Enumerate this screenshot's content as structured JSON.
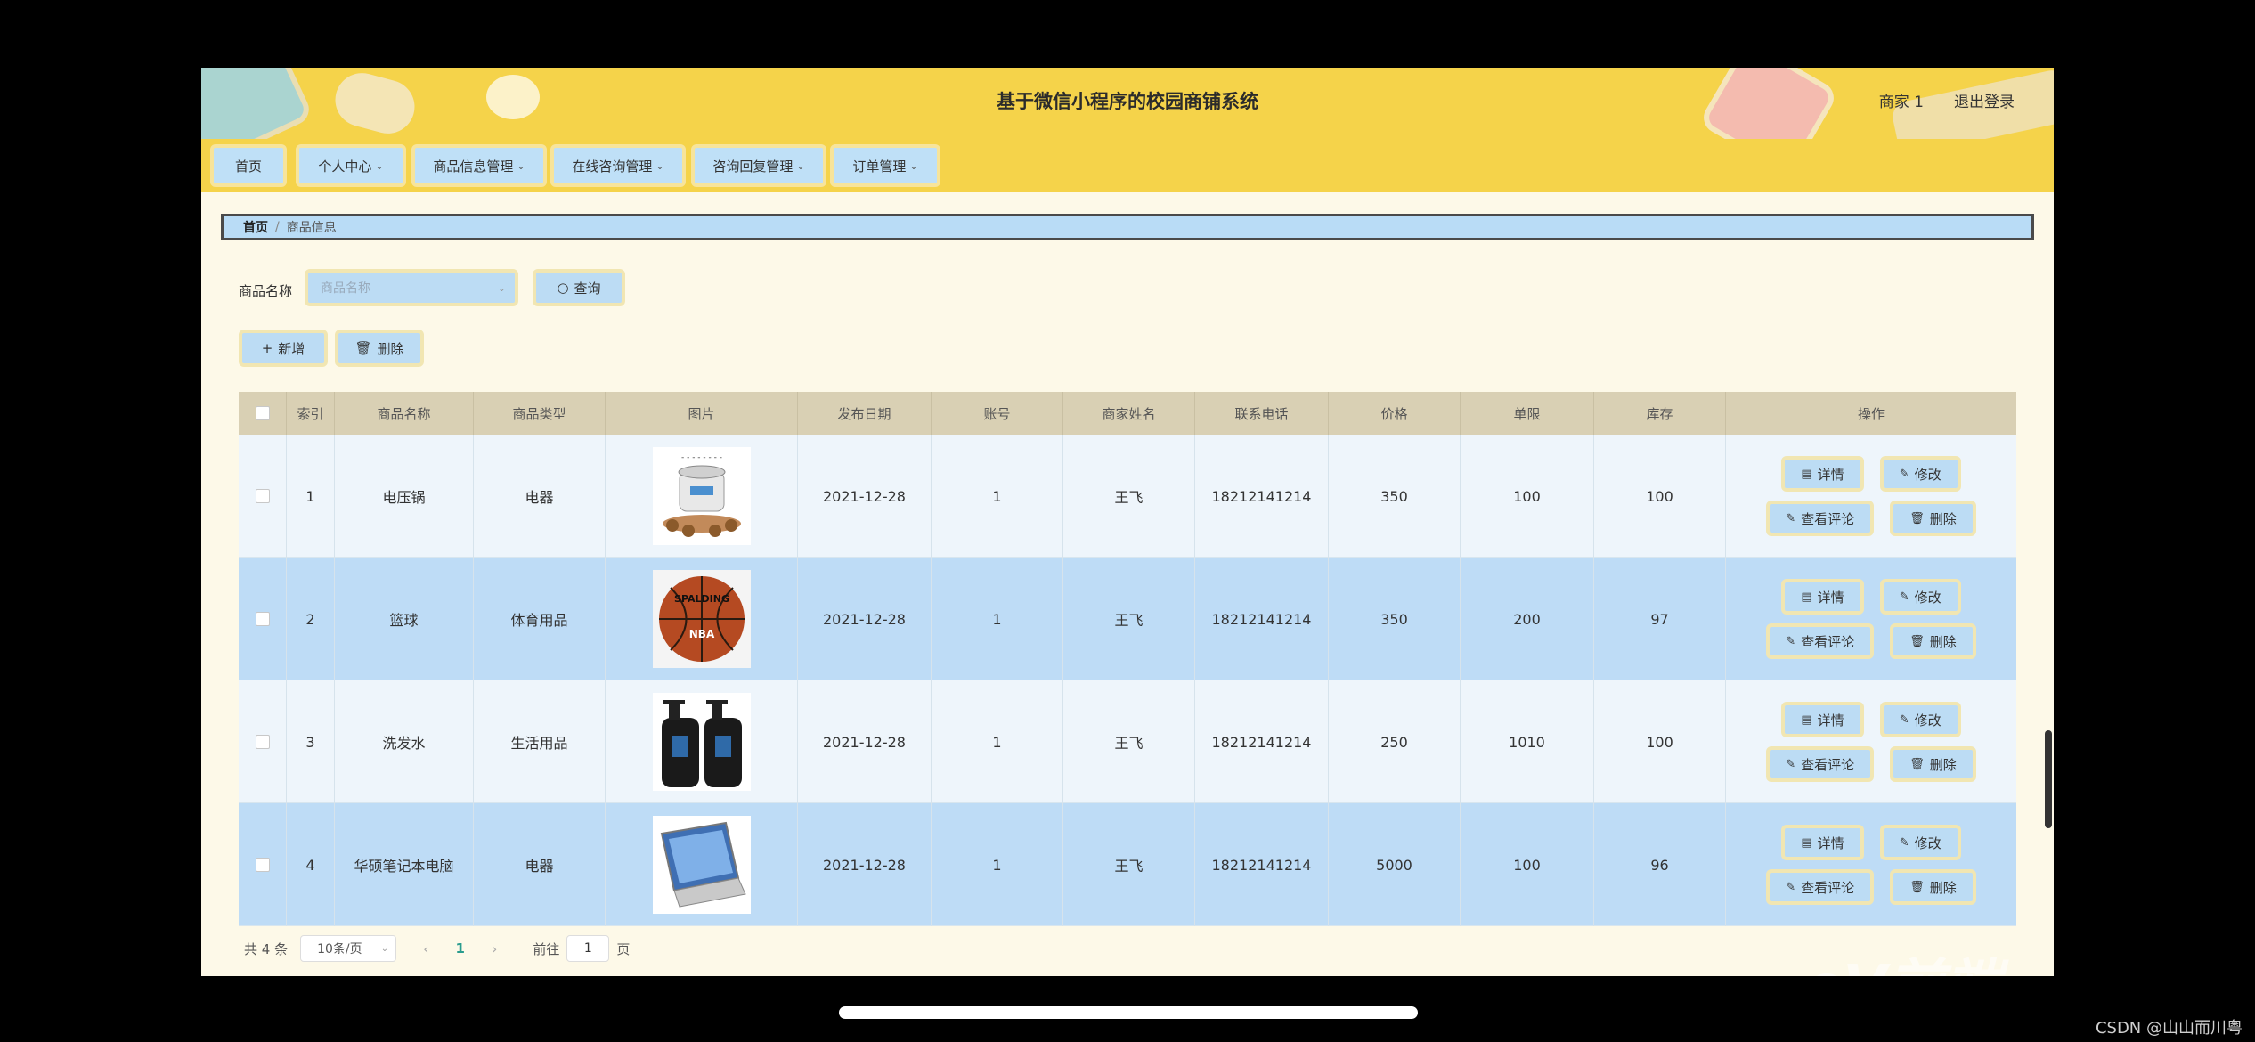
{
  "header": {
    "title": "基于微信小程序的校园商铺系统",
    "user": "商家 1",
    "logout": "退出登录"
  },
  "nav": [
    {
      "label": "首页",
      "has_dropdown": false
    },
    {
      "label": "个人中心",
      "has_dropdown": true
    },
    {
      "label": "商品信息管理",
      "has_dropdown": true
    },
    {
      "label": "在线咨询管理",
      "has_dropdown": true
    },
    {
      "label": "咨询回复管理",
      "has_dropdown": true
    },
    {
      "label": "订单管理",
      "has_dropdown": true
    }
  ],
  "breadcrumb": {
    "home": "首页",
    "current": "商品信息"
  },
  "search": {
    "label": "商品名称",
    "placeholder": "商品名称",
    "button": "查询"
  },
  "actions": {
    "add": "新增",
    "delete": "删除"
  },
  "table": {
    "headers": [
      "索引",
      "商品名称",
      "商品类型",
      "图片",
      "发布日期",
      "账号",
      "商家姓名",
      "联系电话",
      "价格",
      "单限",
      "库存",
      "操作"
    ],
    "rows": [
      {
        "index": "1",
        "name": "电压锅",
        "type": "电器",
        "image": "pressure-cooker",
        "date": "2021-12-28",
        "account": "1",
        "merchant": "王飞",
        "phone": "18212141214",
        "price": "350",
        "limit": "100",
        "stock": "100"
      },
      {
        "index": "2",
        "name": "篮球",
        "type": "体育用品",
        "image": "basketball",
        "date": "2021-12-28",
        "account": "1",
        "merchant": "王飞",
        "phone": "18212141214",
        "price": "350",
        "limit": "200",
        "stock": "97"
      },
      {
        "index": "3",
        "name": "洗发水",
        "type": "生活用品",
        "image": "shampoo-bottles",
        "date": "2021-12-28",
        "account": "1",
        "merchant": "王飞",
        "phone": "18212141214",
        "price": "250",
        "limit": "1010",
        "stock": "100"
      },
      {
        "index": "4",
        "name": "华硕笔记本电脑",
        "type": "电器",
        "image": "laptop",
        "date": "2021-12-28",
        "account": "1",
        "merchant": "王飞",
        "phone": "18212141214",
        "price": "5000",
        "limit": "100",
        "stock": "96"
      }
    ],
    "row_actions": {
      "detail": "详情",
      "edit": "修改",
      "reviews": "查看评论",
      "delete": "删除"
    }
  },
  "pagination": {
    "total": "共 4 条",
    "page_size": "10条/页",
    "current_page": "1",
    "goto_label": "前往",
    "goto_value": "1",
    "page_suffix": "页"
  },
  "watermark": "eV前端",
  "credit": "CSDN @山山而川粤"
}
